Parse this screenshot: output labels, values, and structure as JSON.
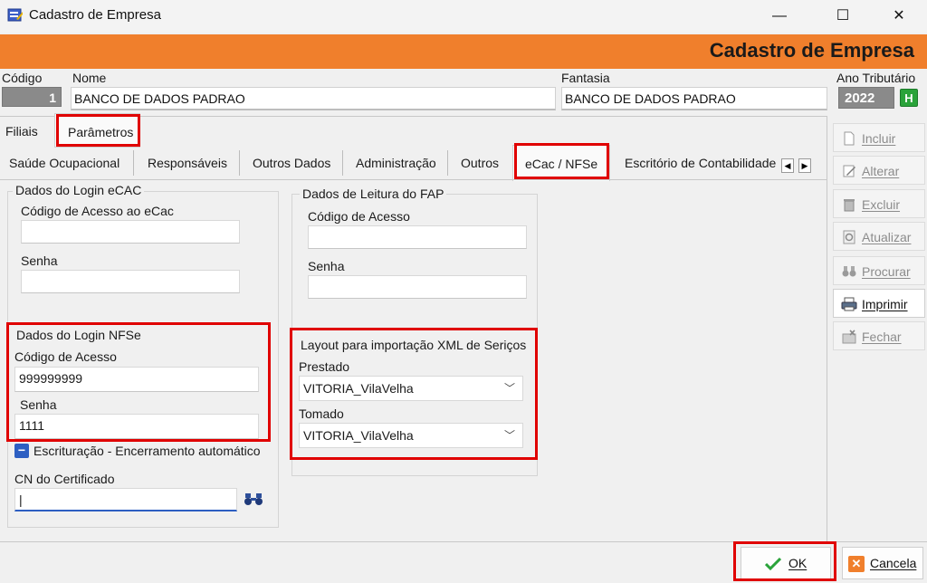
{
  "window": {
    "title": "Cadastro de Empresa",
    "minimize": "—",
    "maximize": "☐",
    "close": "✕"
  },
  "header": {
    "title": "Cadastro de Empresa"
  },
  "fields": {
    "codigo_label": "Código",
    "codigo_value": "1",
    "nome_label": "Nome",
    "nome_value": "BANCO DE DADOS PADRAO",
    "fantasia_label": "Fantasia",
    "fantasia_value": "BANCO DE DADOS PADRAO",
    "ano_label": "Ano Tributário",
    "ano_value": "2022",
    "ano_button": "H"
  },
  "top_tabs": [
    "Filiais",
    "Parâmetros"
  ],
  "sub_tabs": [
    "Saúde Ocupacional",
    "Responsáveis",
    "Outros Dados",
    "Administração",
    "Outros",
    "eCac / NFSe",
    "Escritório de Contabilidade"
  ],
  "ecac_group": {
    "title": "Dados do Login eCAC",
    "codigo_label": "Código de Acesso ao eCac",
    "codigo_value": "",
    "senha_label": "Senha",
    "senha_value": ""
  },
  "fap_group": {
    "title": "Dados de Leitura do FAP",
    "codigo_label": "Código de Acesso",
    "codigo_value": "",
    "senha_label": "Senha",
    "senha_value": ""
  },
  "nfse_group": {
    "title": "Dados do Login NFSe",
    "codigo_label": "Código de Acesso",
    "codigo_value": "999999999",
    "senha_label": "Senha",
    "senha_value": "1111"
  },
  "escrituracao": {
    "label": "Escrituração - Encerramento automático",
    "toggle": "−"
  },
  "certificado": {
    "label": "CN do Certificado",
    "value": "|"
  },
  "layout_group": {
    "title": "Layout para importação XML de Seriços",
    "prestado_label": "Prestado",
    "prestado_value": "VITORIA_VilaVelha",
    "tomado_label": "Tomado",
    "tomado_value": "VITORIA_VilaVelha"
  },
  "sidebar": [
    {
      "label": "Incluir",
      "icon": "document-icon",
      "enabled": false
    },
    {
      "label": "Alterar",
      "icon": "edit-icon",
      "enabled": false
    },
    {
      "label": "Excluir",
      "icon": "trash-icon",
      "enabled": false
    },
    {
      "label": "Atualizar",
      "icon": "refresh-icon",
      "enabled": false
    },
    {
      "label": "Procurar",
      "icon": "binoculars-icon",
      "enabled": false
    },
    {
      "label": "Imprimir",
      "icon": "printer-icon",
      "enabled": true
    },
    {
      "label": "Fechar",
      "icon": "close-folder-icon",
      "enabled": false
    }
  ],
  "buttons": {
    "ok": "OK",
    "cancel": "Cancela"
  },
  "colors": {
    "header": "#f07f2c",
    "highlight": "#e00000",
    "ok_check": "#2aa33a",
    "cancel_icon": "#f07f2c"
  }
}
